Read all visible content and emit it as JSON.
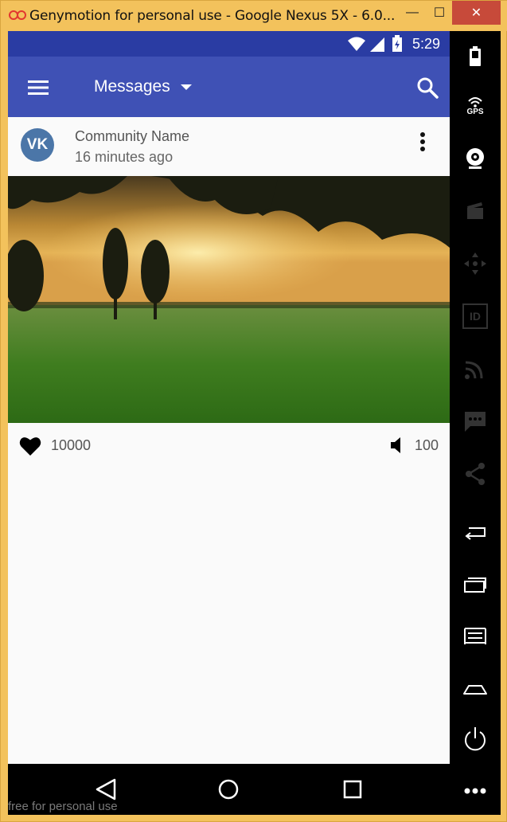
{
  "window": {
    "title": "Genymotion for personal use - Google Nexus 5X - 6.0...",
    "controls": {
      "minimize": "—",
      "maximize": "☐",
      "close": "✕"
    }
  },
  "status_bar": {
    "time": "5:29"
  },
  "toolbar": {
    "title": "Messages"
  },
  "post": {
    "community_name": "Community Name",
    "time_ago": "16 minutes ago",
    "avatar_text": "VK",
    "likes": "10000",
    "audio_count": "100"
  },
  "sidebar": {
    "gps_label": "GPS",
    "id_label": "ID"
  },
  "watermark": "free for personal use",
  "colors": {
    "statusbar": "#2a3ca3",
    "toolbar": "#3f51b5",
    "frame": "#f3c25c",
    "close": "#c74a3a"
  }
}
